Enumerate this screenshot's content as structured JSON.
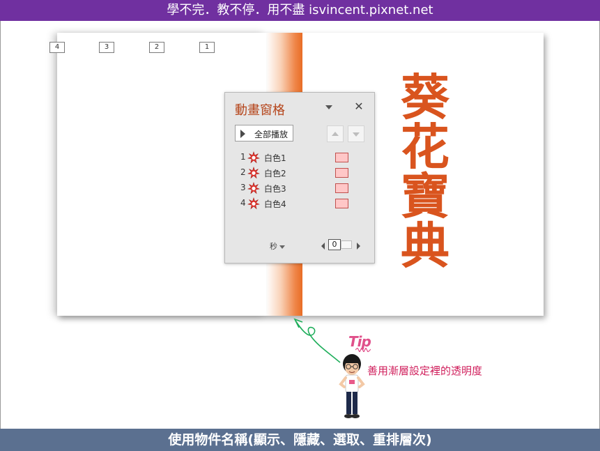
{
  "top_banner": {
    "text": "學不完．教不停．用不盡 isvincent.pixnet.net"
  },
  "bottom_banner": {
    "text": "使用物件名稱(顯示、隱藏、選取、重排層次)"
  },
  "slide": {
    "order_tags": [
      "4",
      "3",
      "2",
      "1"
    ],
    "title_chars": [
      "葵",
      "花",
      "寶",
      "典"
    ]
  },
  "animation_pane": {
    "title": "動畫窗格",
    "play_all_label": "全部播放",
    "items": [
      {
        "number": "1",
        "name": "白色1"
      },
      {
        "number": "2",
        "name": "白色2"
      },
      {
        "number": "3",
        "name": "白色3"
      },
      {
        "number": "4",
        "name": "白色4"
      }
    ],
    "seconds_label": "秒",
    "zoom_value": "0"
  },
  "tip": {
    "logo": "Tip",
    "text": "善用漸層設定裡的透明度"
  },
  "colors": {
    "top_banner": "#7030a0",
    "bottom_banner": "#5b7090",
    "title_orange": "#d9541e",
    "tip_pink": "#d01f5c",
    "arrow_green": "#1fae5b"
  }
}
